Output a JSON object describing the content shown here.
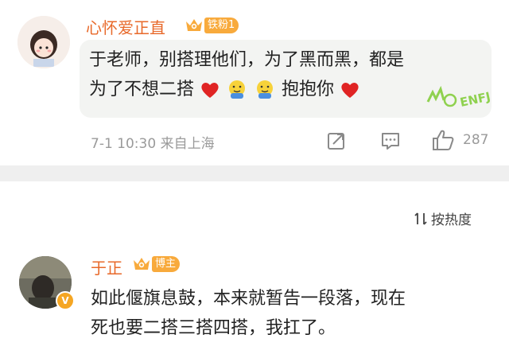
{
  "comment1": {
    "username": "心怀爱正直",
    "fan_badge": "铁粉1",
    "text_line1": "于老师，别搭理他们，为了黑而黑，都是",
    "text_line2_start": "为了不想二搭",
    "text_line2_end": "抱抱你",
    "personality_badge": "ENFJ",
    "time": "7-1 10:30",
    "source": "来自上海",
    "like_count": "287",
    "icons": [
      "share-icon",
      "comment-icon",
      "like-icon"
    ]
  },
  "sort": {
    "label": "按热度"
  },
  "comment2": {
    "username": "于正",
    "role_badge": "博主",
    "verified_mark": "V",
    "text_line1": "如此偃旗息鼓，本来就暂告一段落，现在",
    "text_line2": "死也要二搭三搭四搭，我扛了。"
  },
  "colors": {
    "username": "#e8692a",
    "badge": "#f8aa3c",
    "divider": "#efefef",
    "meta": "#9a9a9a"
  }
}
